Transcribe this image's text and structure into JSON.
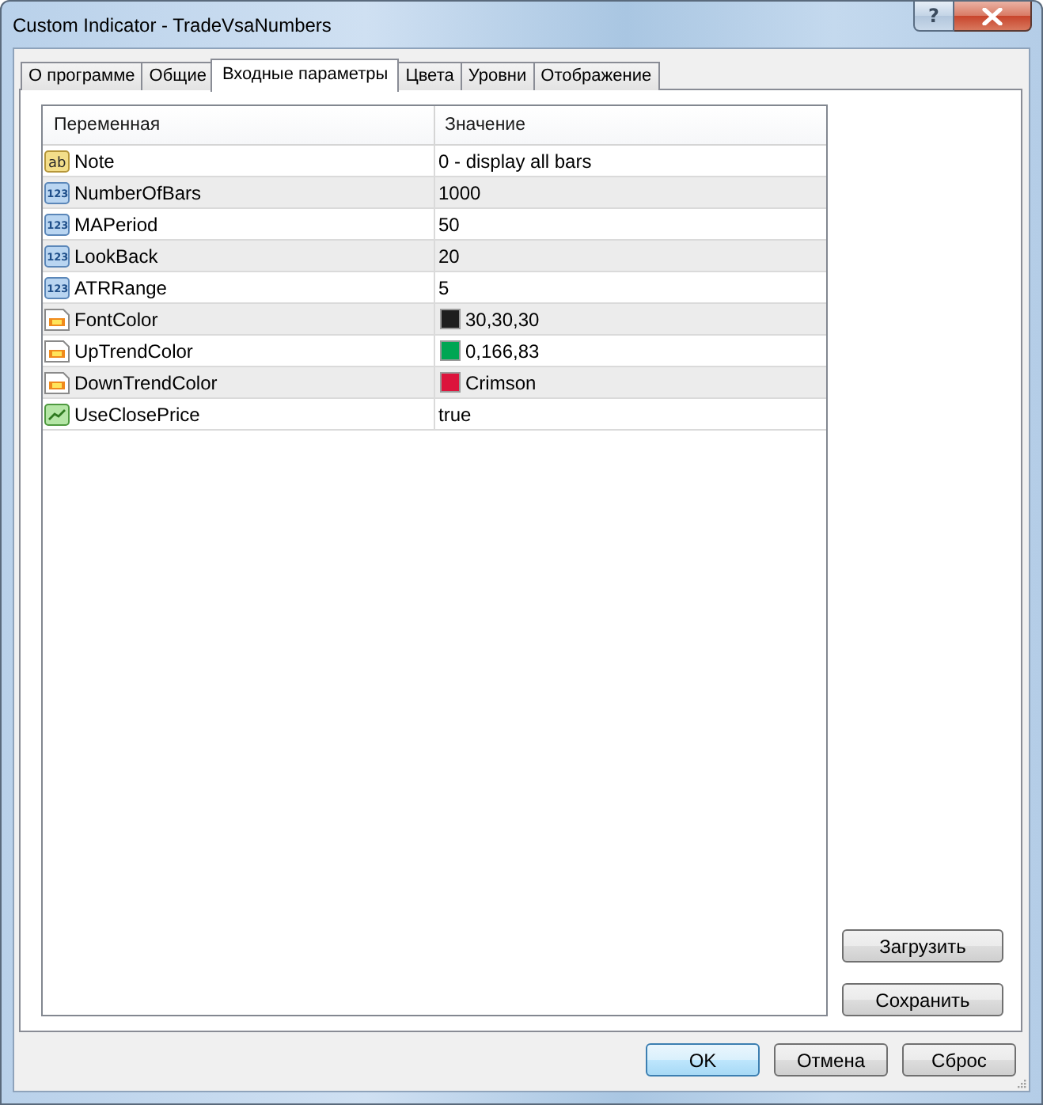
{
  "window": {
    "title": "Custom Indicator - TradeVsaNumbers",
    "help_glyph": "?"
  },
  "tabs": [
    {
      "label": "О программе",
      "selected": false
    },
    {
      "label": "Общие",
      "selected": false
    },
    {
      "label": "Входные параметры",
      "selected": true
    },
    {
      "label": "Цвета",
      "selected": false
    },
    {
      "label": "Уровни",
      "selected": false
    },
    {
      "label": "Отображение",
      "selected": false
    }
  ],
  "table": {
    "columns": [
      "Переменная",
      "Значение"
    ],
    "rows": [
      {
        "kind": "string",
        "type_label": "ab",
        "name": "Note",
        "value": "0 - display all bars"
      },
      {
        "kind": "int",
        "type_label": "123",
        "name": "NumberOfBars",
        "value": "1000"
      },
      {
        "kind": "int",
        "type_label": "123",
        "name": "MAPeriod",
        "value": "50"
      },
      {
        "kind": "int",
        "type_label": "123",
        "name": "LookBack",
        "value": "20"
      },
      {
        "kind": "int",
        "type_label": "123",
        "name": "ATRRange",
        "value": "5"
      },
      {
        "kind": "color",
        "name": "FontColor",
        "value": "30,30,30",
        "color": "#1e1e1e"
      },
      {
        "kind": "color",
        "name": "UpTrendColor",
        "value": "0,166,83",
        "color": "#00a653"
      },
      {
        "kind": "color",
        "name": "DownTrendColor",
        "value": "Crimson",
        "color": "#dc143c"
      },
      {
        "kind": "bool",
        "name": "UseClosePrice",
        "value": "true"
      }
    ]
  },
  "side_buttons": [
    "Загрузить",
    "Сохранить"
  ],
  "buttons": [
    {
      "label": "OK",
      "default": true
    },
    {
      "label": "Отмена",
      "default": false
    },
    {
      "label": "Сброс",
      "default": false
    }
  ]
}
